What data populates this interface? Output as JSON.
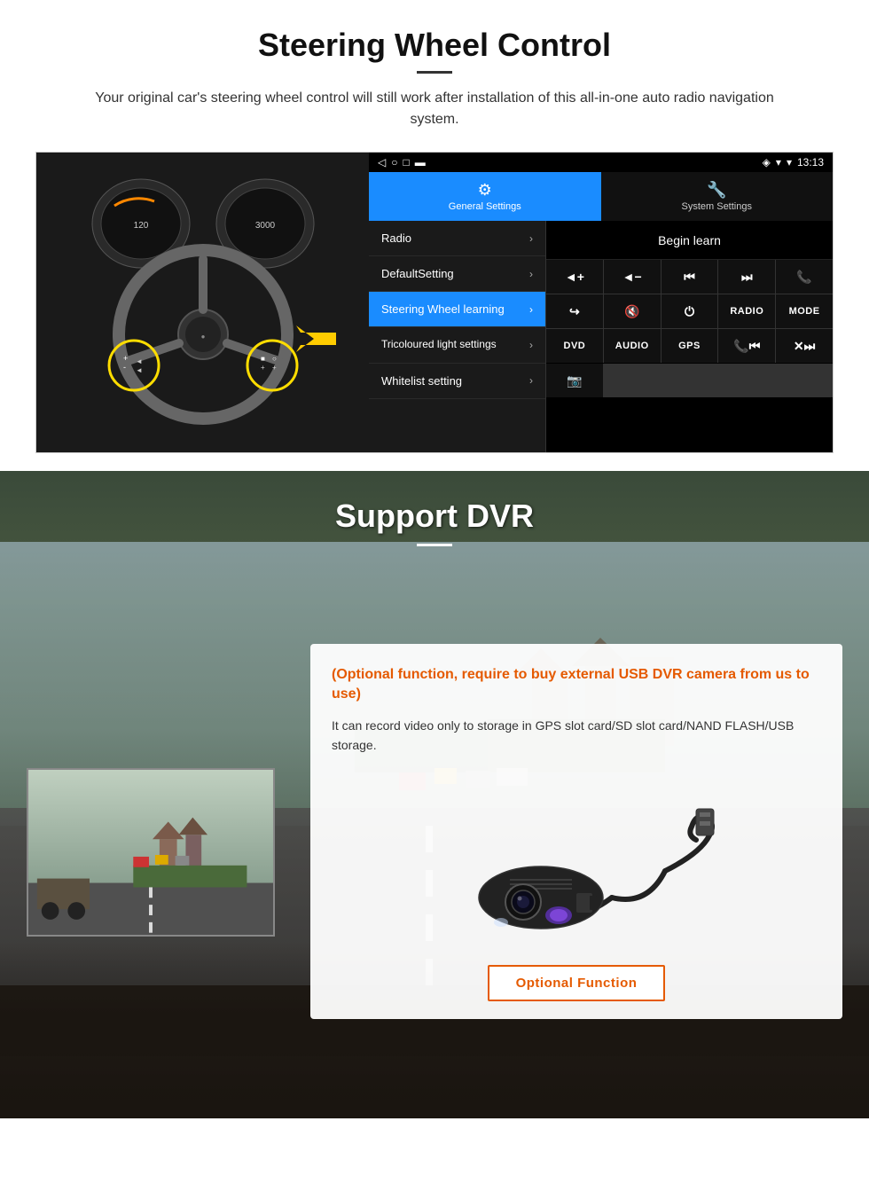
{
  "steering": {
    "title": "Steering Wheel Control",
    "subtitle": "Your original car's steering wheel control will still work after installation of this all-in-one auto radio navigation system.",
    "status_bar": {
      "time": "13:13",
      "signal_icon": "▼",
      "wifi_icon": "▾"
    },
    "tabs": [
      {
        "id": "general",
        "icon": "⚙",
        "label": "General Settings",
        "active": true
      },
      {
        "id": "system",
        "icon": "🔧",
        "label": "System Settings",
        "active": false
      }
    ],
    "menu_items": [
      {
        "id": "radio",
        "label": "Radio",
        "selected": false
      },
      {
        "id": "default",
        "label": "DefaultSetting",
        "selected": false
      },
      {
        "id": "steering",
        "label": "Steering Wheel learning",
        "selected": true
      },
      {
        "id": "tricoloured",
        "label": "Tricoloured light settings",
        "selected": false
      },
      {
        "id": "whitelist",
        "label": "Whitelist setting",
        "selected": false
      }
    ],
    "begin_learn_label": "Begin learn",
    "control_buttons": [
      {
        "id": "vol-up",
        "icon": "▐+",
        "unicode": "◄+"
      },
      {
        "id": "vol-down",
        "icon": "◄-",
        "unicode": "◄-"
      },
      {
        "id": "prev-track",
        "icon": "|◄◄",
        "unicode": "⏮"
      },
      {
        "id": "next-track",
        "icon": "►►|",
        "unicode": "⏭"
      },
      {
        "id": "phone",
        "icon": "📞",
        "unicode": "☎"
      },
      {
        "id": "hang-up",
        "icon": "↩",
        "unicode": "↩"
      },
      {
        "id": "mute",
        "icon": "◄×",
        "unicode": "🔇"
      },
      {
        "id": "power",
        "icon": "⏻",
        "unicode": "⏻"
      },
      {
        "id": "radio-btn",
        "label": "RADIO",
        "unicode": ""
      },
      {
        "id": "mode-btn",
        "label": "MODE",
        "unicode": ""
      },
      {
        "id": "dvd-btn",
        "label": "DVD",
        "unicode": ""
      },
      {
        "id": "audio-btn",
        "label": "AUDIO",
        "unicode": ""
      },
      {
        "id": "gps-btn",
        "label": "GPS",
        "unicode": ""
      },
      {
        "id": "tel-prev",
        "icon": "☎|◄◄",
        "unicode": "📞⏮"
      },
      {
        "id": "tel-next",
        "icon": "×►► ",
        "unicode": "×⏭"
      },
      {
        "id": "camera-icon",
        "icon": "📷",
        "unicode": "📷"
      }
    ]
  },
  "dvr": {
    "title": "Support DVR",
    "optional_title": "(Optional function, require to buy external USB DVR camera from us to use)",
    "description": "It can record video only to storage in GPS slot card/SD slot card/NAND FLASH/USB storage.",
    "optional_function_label": "Optional Function"
  }
}
